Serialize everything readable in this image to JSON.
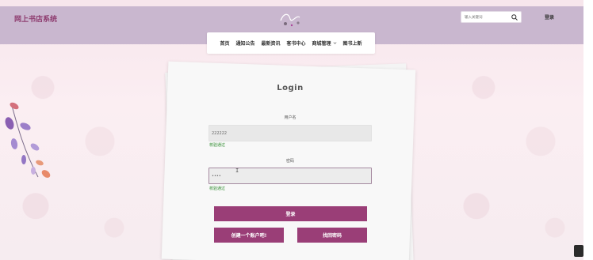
{
  "header": {
    "site_title": "网上书店系统",
    "search_placeholder": "输入关键词",
    "login_link": "登录"
  },
  "nav": {
    "items": [
      {
        "label": "首页"
      },
      {
        "label": "通知公告"
      },
      {
        "label": "最新资讯"
      },
      {
        "label": "客书中心"
      },
      {
        "label": "商城管理",
        "has_dropdown": true
      },
      {
        "label": "图书上新"
      }
    ]
  },
  "login_card": {
    "title": "Login",
    "username_label": "用户名",
    "username_value": "222222",
    "username_hint": "校验通过",
    "password_label": "密码",
    "password_value": "••••",
    "password_hint": "校验通过",
    "login_button": "登录",
    "register_button": "创建一个账户吧!",
    "forgot_button": "找回密码"
  },
  "colors": {
    "accent": "#9a3e77",
    "topbar": "#c9b7cf",
    "title": "#8e3c6f",
    "hint_ok": "#2c8a2c"
  }
}
